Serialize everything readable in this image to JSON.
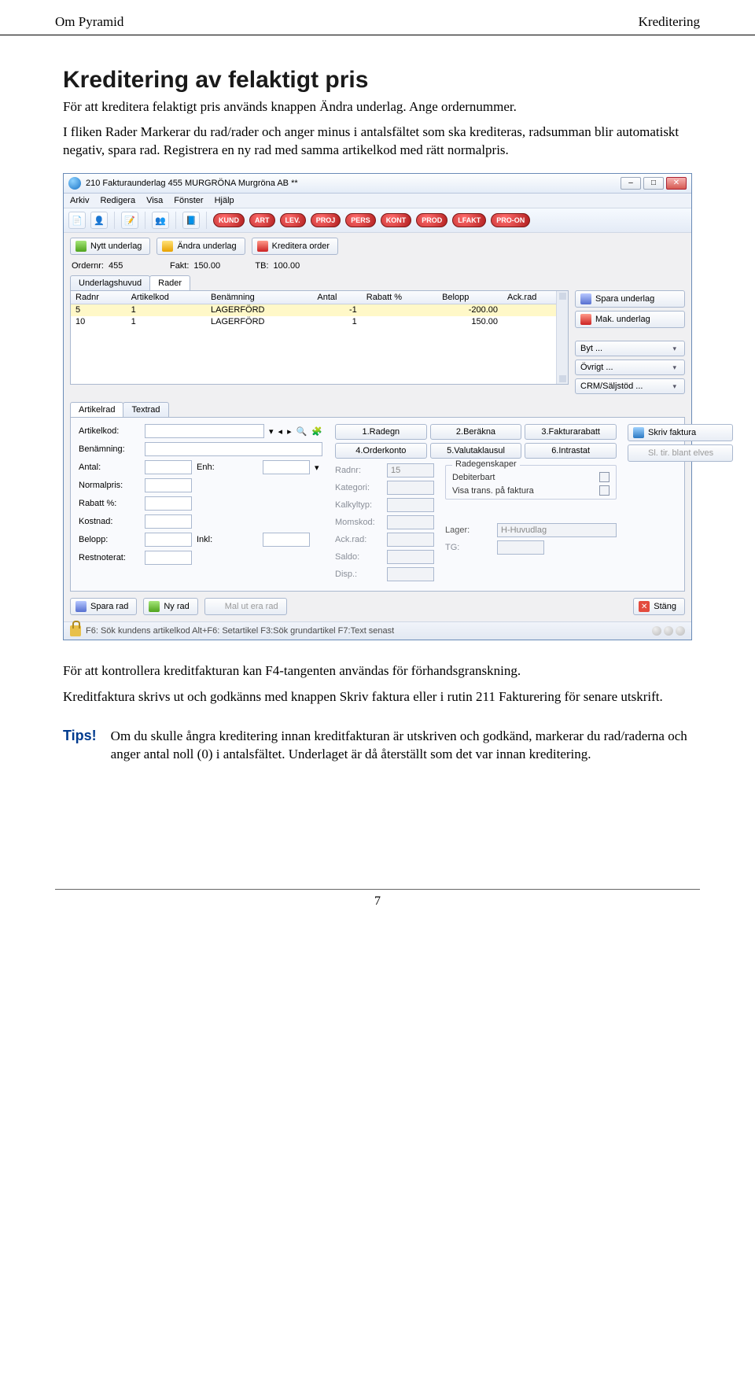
{
  "header": {
    "left": "Om Pyramid",
    "right": "Kreditering"
  },
  "section": {
    "title": "Kreditering av felaktigt pris",
    "p1": "För att kreditera felaktigt pris används knappen Ändra underlag. Ange ordernummer.",
    "p2": "I fliken Rader Markerar du rad/rader och anger minus i antalsfältet som ska krediteras, radsumman blir automatiskt negativ, spara rad. Registrera en ny rad med samma artikelkod med rätt normalpris.",
    "p3": "För att kontrollera kreditfakturan kan F4-tangenten användas för förhandsgranskning.",
    "p4": "Kreditfaktura skrivs ut och godkänns med knappen Skriv faktura eller i rutin 211 Fakturering för senare utskrift."
  },
  "tips": {
    "label": "Tips!",
    "text": "Om du skulle ångra kreditering innan kreditfakturan är utskriven och godkänd, markerar du rad/raderna och anger antal noll (0) i antalsfältet. Underlaget är då återställt som det var innan kreditering."
  },
  "app": {
    "title": "210 Fakturaunderlag 455 MURGRÖNA  Murgröna AB **",
    "menu": [
      "Arkiv",
      "Redigera",
      "Visa",
      "Fönster",
      "Hjälp"
    ],
    "pills": [
      "KUND",
      "ART",
      "LEV.",
      "PROJ",
      "PERS",
      "KONT",
      "PROD",
      "LFAKT",
      "PRO-ON"
    ],
    "actions": {
      "new": "Nytt underlag",
      "edit": "Ändra underlag",
      "credit": "Kreditera order"
    },
    "fields": {
      "order_label": "Ordernr:",
      "order_val": "455",
      "fakt_label": "Fakt:",
      "fakt_val": "150.00",
      "tb_label": "TB:",
      "tb_val": "100.00"
    },
    "tabs_upper": [
      "Underlagshuvud",
      "Rader"
    ],
    "grid": {
      "cols": [
        "Radnr",
        "Artikelkod",
        "Benämning",
        "Antal",
        "Rabatt %",
        "Belopp",
        "Ack.rad"
      ],
      "rows": [
        {
          "radnr": "5",
          "art": "1",
          "ben": "LAGERFÖRD",
          "antal": "-1",
          "rabatt": "",
          "belopp": "-200.00",
          "ack": ""
        },
        {
          "radnr": "10",
          "art": "1",
          "ben": "LAGERFÖRD",
          "antal": "1",
          "rabatt": "",
          "belopp": "150.00",
          "ack": ""
        }
      ]
    },
    "side": {
      "save": "Spara underlag",
      "mak": "Mak. underlag",
      "byt": "Byt ...",
      "ovrigt": "Övrigt ...",
      "crm": "CRM/Säljstöd ..."
    },
    "tabs_lower": [
      "Artikelrad",
      "Textrad"
    ],
    "form": {
      "artikelkod": "Artikelkod:",
      "benamning": "Benämning:",
      "antal": "Antal:",
      "enh": "Enh:",
      "normalpris": "Normalpris:",
      "rabatt": "Rabatt %:",
      "kostnad": "Kostnad:",
      "belopp": "Belopp:",
      "inkl": "Inkl:",
      "restnoterat": "Restnoterat:"
    },
    "six": [
      "1.Radegn",
      "2.Beräkna",
      "3.Fakturarabatt",
      "4.Orderkonto",
      "5.Valutaklausul",
      "6.Intrastat"
    ],
    "grey": {
      "radnr_l": "Radnr:",
      "radnr_v": "15",
      "kategori": "Kategori:",
      "kalkyltyp": "Kalkyltyp:",
      "momskod": "Momskod:",
      "ackrad": "Ack.rad:",
      "saldo": "Saldo:",
      "disp": "Disp.:",
      "lager": "Lager:",
      "lager_v": "H-Huvudlag",
      "tg": "TG:"
    },
    "radegrp": {
      "title": "Radegenskaper",
      "debit": "Debiterbart",
      "visa": "Visa trans. på faktura"
    },
    "right": {
      "skriv": "Skriv faktura",
      "slite": "Sl. tir. blant elves"
    },
    "bottom": {
      "spara": "Spara rad",
      "ny": "Ny rad",
      "mal": "Mal ut era rad",
      "stang": "Stäng"
    },
    "status": "F6: Sök kundens artikelkod Alt+F6: Setartikel F3:Sök grundartikel F7:Text senast"
  },
  "footer": {
    "page": "7"
  }
}
